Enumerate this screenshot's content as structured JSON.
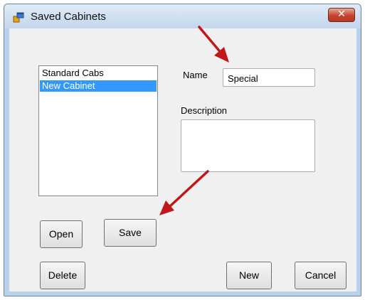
{
  "window": {
    "title": "Saved Cabinets",
    "close_glyph": "✕",
    "app_icon": "window-app-icon"
  },
  "cabinet_list": {
    "items": [
      {
        "label": "Standard Cabs",
        "selected": false
      },
      {
        "label": "New Cabinet",
        "selected": true
      }
    ]
  },
  "form": {
    "name_label": "Name",
    "name_value": "Special",
    "description_label": "Description",
    "description_value": ""
  },
  "buttons": {
    "open": "Open",
    "save": "Save",
    "delete": "Delete",
    "new": "New",
    "cancel": "Cancel"
  },
  "colors": {
    "selection": "#3399ff",
    "annotation_arrow": "#c0171b",
    "close_button": "#c7442c"
  }
}
